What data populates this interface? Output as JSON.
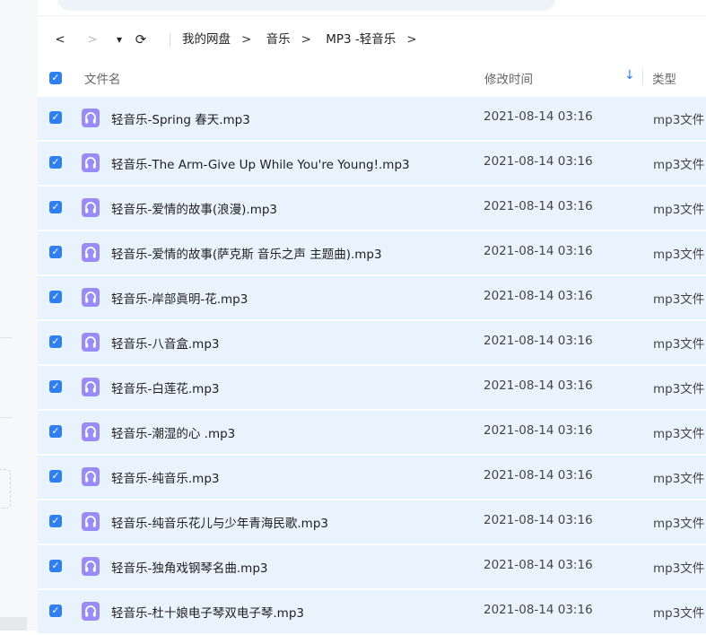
{
  "nav": {
    "back_glyph": "<",
    "forward_glyph": ">",
    "dropdown_glyph": "▾",
    "refresh_glyph": "⟳",
    "breadcrumbs": [
      "我的网盘",
      "音乐",
      "MP3 -轻音乐"
    ],
    "breadcrumb_separator": ">"
  },
  "columns": {
    "name": "文件名",
    "modified": "修改时间",
    "type": "类型",
    "sort_indicator": "↓"
  },
  "colors": {
    "accent": "#2f7ff0",
    "row_selected": "#e9f3fd",
    "file_icon": "#9a8cf7"
  },
  "files": [
    {
      "name": "轻音乐-Spring 春天.mp3",
      "modified": "2021-08-14 03:16",
      "type": "mp3文件",
      "icon": "headphones-icon",
      "selected": true
    },
    {
      "name": "轻音乐-The Arm-Give Up While You're Young!.mp3",
      "modified": "2021-08-14 03:16",
      "type": "mp3文件",
      "icon": "headphones-icon",
      "selected": true
    },
    {
      "name": "轻音乐-爱情的故事(浪漫).mp3",
      "modified": "2021-08-14 03:16",
      "type": "mp3文件",
      "icon": "headphones-icon",
      "selected": true
    },
    {
      "name": "轻音乐-爱情的故事(萨克斯 音乐之声 主题曲).mp3",
      "modified": "2021-08-14 03:16",
      "type": "mp3文件",
      "icon": "headphones-icon",
      "selected": true
    },
    {
      "name": "轻音乐-岸部眞明-花.mp3",
      "modified": "2021-08-14 03:16",
      "type": "mp3文件",
      "icon": "headphones-icon",
      "selected": true
    },
    {
      "name": "轻音乐-八音盒.mp3",
      "modified": "2021-08-14 03:16",
      "type": "mp3文件",
      "icon": "headphones-icon",
      "selected": true
    },
    {
      "name": "轻音乐-白莲花.mp3",
      "modified": "2021-08-14 03:16",
      "type": "mp3文件",
      "icon": "headphones-icon",
      "selected": true
    },
    {
      "name": "轻音乐-潮湿的心 .mp3",
      "modified": "2021-08-14 03:16",
      "type": "mp3文件",
      "icon": "headphones-icon",
      "selected": true
    },
    {
      "name": "轻音乐-纯音乐.mp3",
      "modified": "2021-08-14 03:16",
      "type": "mp3文件",
      "icon": "headphones-icon",
      "selected": true
    },
    {
      "name": "轻音乐-纯音乐花儿与少年青海民歌.mp3",
      "modified": "2021-08-14 03:16",
      "type": "mp3文件",
      "icon": "headphones-icon",
      "selected": true
    },
    {
      "name": "轻音乐-独角戏钢琴名曲.mp3",
      "modified": "2021-08-14 03:16",
      "type": "mp3文件",
      "icon": "headphones-icon",
      "selected": true
    },
    {
      "name": "轻音乐-杜十娘电子琴双电子琴.mp3",
      "modified": "2021-08-14 03:16",
      "type": "mp3文件",
      "icon": "headphones-icon",
      "selected": true
    }
  ]
}
